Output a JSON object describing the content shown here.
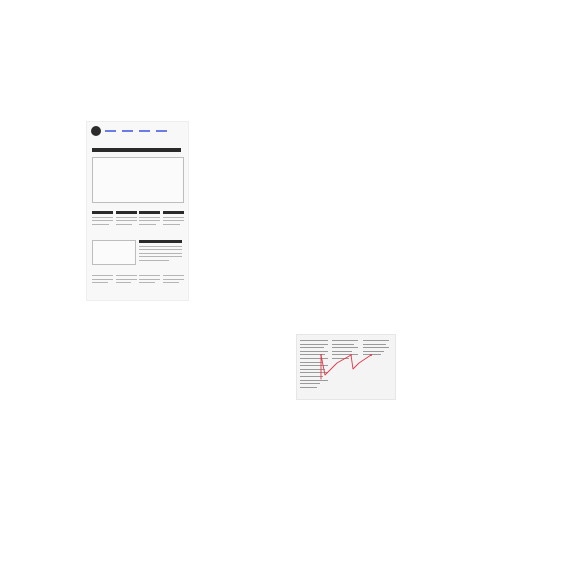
{
  "wireframe": {
    "colors": {
      "card_bg": "#f8f8f8",
      "ink": "#2a2a2a",
      "nav_link": "#6d7be8",
      "rule": "#b5b5b5",
      "box_border": "#bdbdbd"
    },
    "nav_links": 4,
    "columns": 4,
    "footer_columns": 4
  },
  "document": {
    "colors": {
      "paper": "#f4f4f4",
      "text_rule": "#9a9a9a",
      "trend_line": "#e03a4a"
    },
    "text_columns": 3,
    "trend_shape": "zigzag-upward"
  }
}
